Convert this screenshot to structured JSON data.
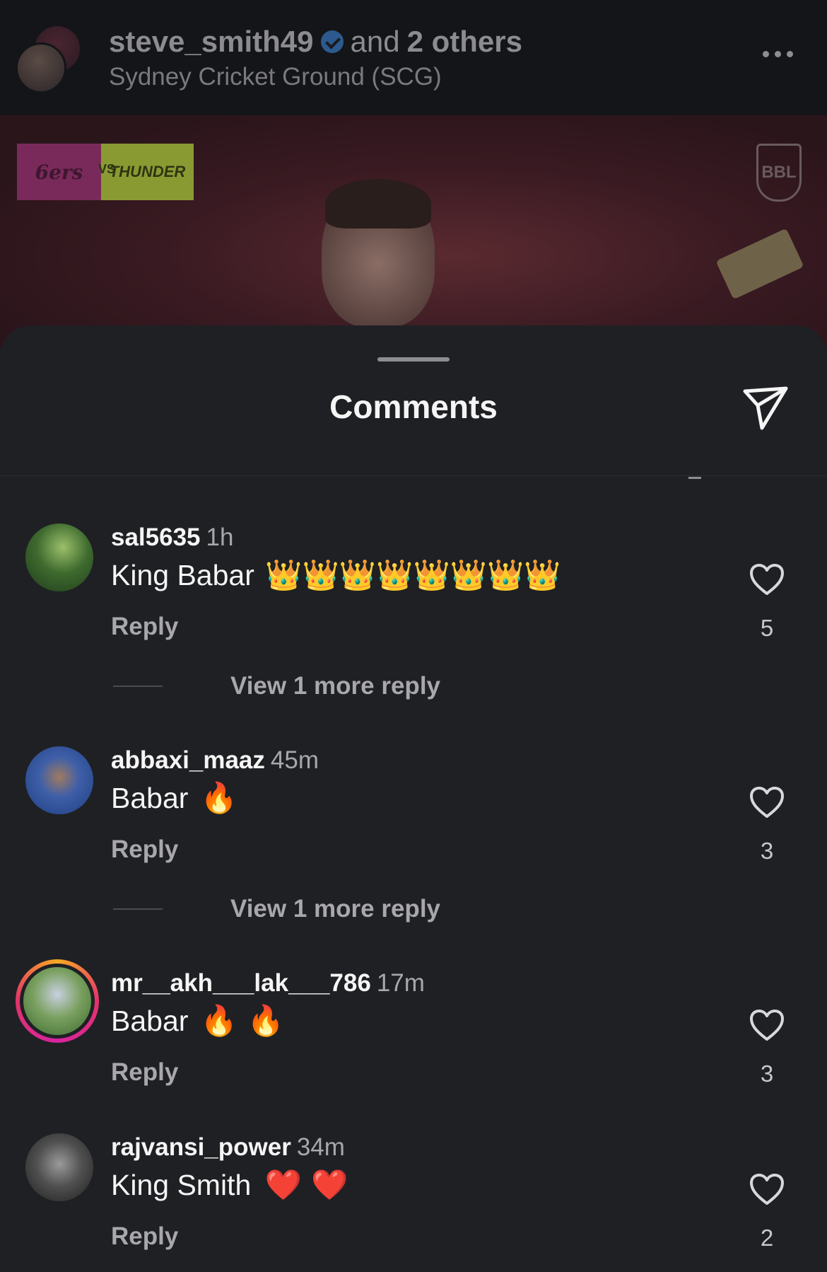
{
  "post": {
    "username": "steve_smith49",
    "and_text": "and",
    "others": "2 others",
    "location": "Sydney Cricket Ground (SCG)",
    "badge_left": "6ers",
    "badge_vs": "VS",
    "badge_right": "THUNDER",
    "league_logo": "BBL"
  },
  "sheet": {
    "title": "Comments"
  },
  "comments": [
    {
      "username": "sal5635",
      "time": "1h",
      "text": "King Babar",
      "emoji": "👑👑👑👑👑👑👑👑",
      "reply_label": "Reply",
      "likes": "5",
      "view_more": "View 1 more reply"
    },
    {
      "username": "abbaxi_maaz",
      "time": "45m",
      "text": "Babar",
      "emoji": "🔥",
      "reply_label": "Reply",
      "likes": "3",
      "view_more": "View 1 more reply"
    },
    {
      "username": "mr__akh___lak___786",
      "time": "17m",
      "text": "Babar",
      "emoji": "🔥 🔥",
      "reply_label": "Reply",
      "likes": "3"
    },
    {
      "username": "rajvansi_power",
      "time": "34m",
      "text": "King Smith",
      "emoji": "❤️ ❤️",
      "reply_label": "Reply",
      "likes": "2"
    }
  ],
  "colors": {
    "background": "#1f2024",
    "text_primary": "#f5f5f5",
    "text_secondary": "#a8a8ac",
    "story_ring_start": "#f9a825",
    "story_ring_end": "#d6249f"
  }
}
